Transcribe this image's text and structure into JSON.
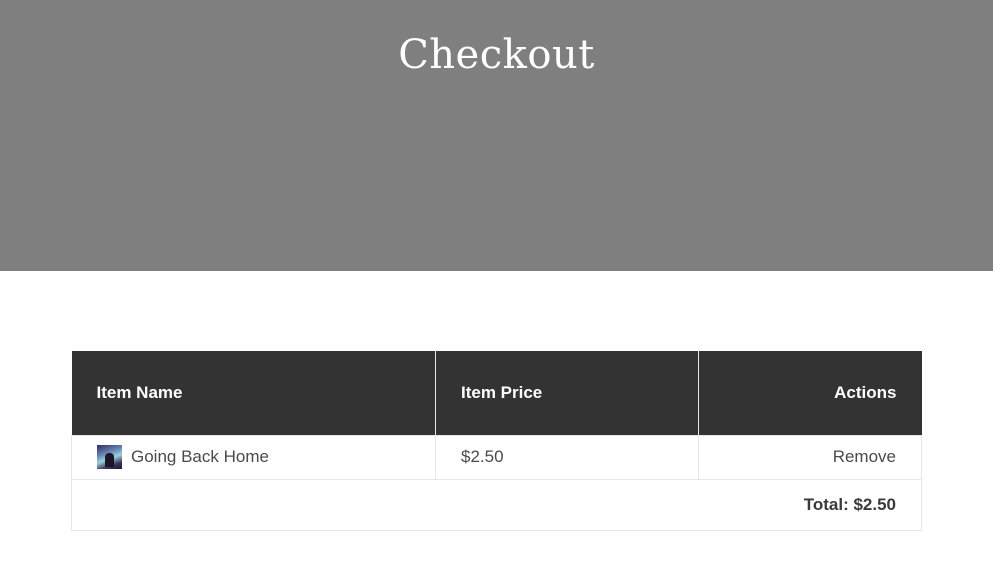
{
  "page": {
    "title": "Checkout"
  },
  "cart": {
    "headers": {
      "name": "Item Name",
      "price": "Item Price",
      "actions": "Actions"
    },
    "items": [
      {
        "name": "Going Back Home",
        "price": "$2.50",
        "action": "Remove",
        "thumbnail_icon": "album-art-thumbnail"
      }
    ],
    "total": "Total: $2.50"
  },
  "colors": {
    "hero_bg": "#7f7f7f",
    "header_bg": "#333333",
    "border": "#e6e6e6"
  }
}
